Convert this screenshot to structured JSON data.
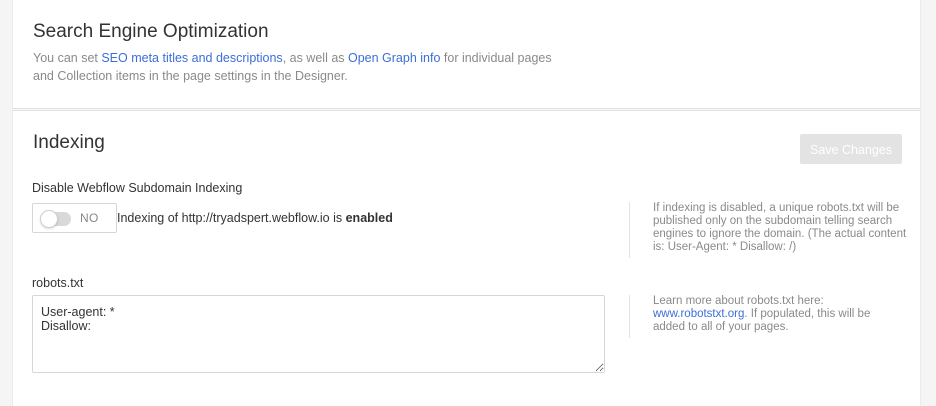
{
  "seo": {
    "title": "Search Engine Optimization",
    "desc_part1": "You can set ",
    "link_meta": "SEO meta titles and descriptions",
    "desc_part2": ", as well as ",
    "link_og": "Open Graph info",
    "desc_part3": " for individual pages and Collection items in the page settings in the Designer."
  },
  "indexing": {
    "title": "Indexing",
    "save_label": "Save Changes",
    "subdomain_label": "Disable Webflow Subdomain Indexing",
    "toggle_state": "NO",
    "status_prefix": "Indexing of http://tryadspert.webflow.io is ",
    "status_value": "enabled",
    "help_indexing": "If indexing is disabled, a unique robots.txt will be published only on the subdomain telling search engines to ignore the domain. (The actual content is: User-Agent: * Disallow: /)",
    "robots_label": "robots.txt",
    "robots_value": "User-agent: *\nDisallow:",
    "help_robots_prefix": "Learn more about robots.txt here: ",
    "help_robots_link": "www.robotstxt.org",
    "help_robots_suffix": ". If populated, this will be added to all of your pages."
  },
  "colors": {
    "link": "#3b6fd8",
    "muted_text": "#8a8a8a",
    "disabled_button": "#e3e3e3"
  }
}
